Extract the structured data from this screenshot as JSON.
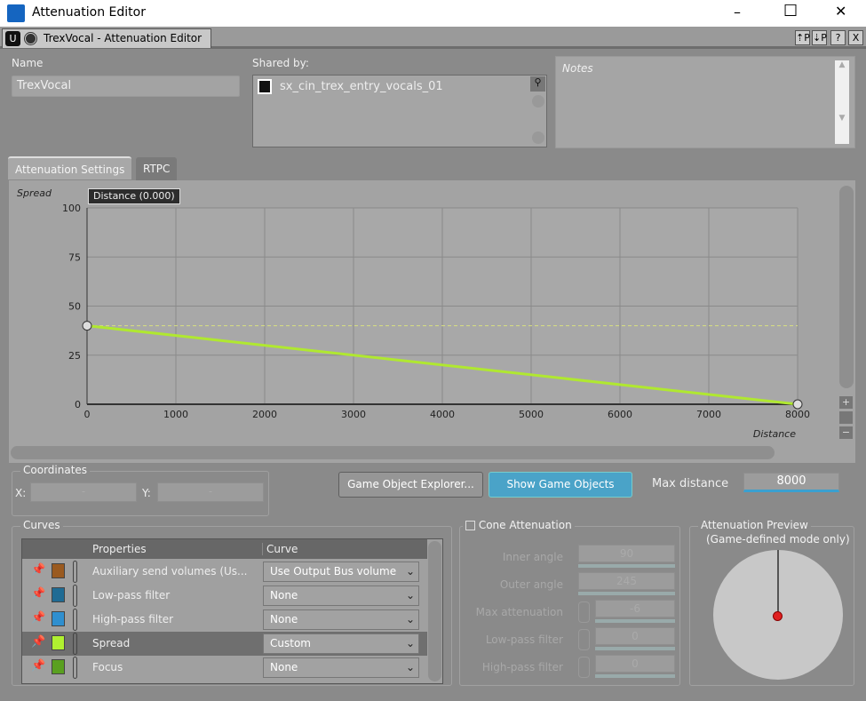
{
  "window": {
    "title": "Attenuation Editor",
    "minimize": "–",
    "maximize": "☐",
    "close": "✕"
  },
  "doc_tab": {
    "title": "TrexVocal - Attenuation Editor",
    "buttons": [
      "⇡P",
      "⇣P",
      "?",
      "X"
    ]
  },
  "name": {
    "label": "Name",
    "value": "TrexVocal"
  },
  "shared_by": {
    "label": "Shared by:",
    "items": [
      "sx_cin_trex_entry_vocals_01"
    ]
  },
  "notes": {
    "placeholder": "Notes"
  },
  "tabs": [
    {
      "label": "Attenuation Settings",
      "active": true
    },
    {
      "label": "RTPC",
      "active": false
    }
  ],
  "graph": {
    "tooltip": "Distance (0.000)"
  },
  "chart_data": {
    "type": "line",
    "ylabel": "Spread",
    "xlabel": "Distance",
    "xlim": [
      0,
      8000
    ],
    "ylim": [
      0,
      100
    ],
    "xticks": [
      0,
      1000,
      2000,
      3000,
      4000,
      5000,
      6000,
      7000,
      8000
    ],
    "yticks": [
      0,
      25,
      50,
      75,
      100
    ],
    "grid": true,
    "series": [
      {
        "name": "Spread",
        "color": "#b0e830",
        "points": [
          [
            0,
            40
          ],
          [
            8000,
            0
          ]
        ]
      }
    ],
    "reference_line": {
      "y": 40,
      "color": "#d8e080"
    }
  },
  "coordinates": {
    "label": "Coordinates",
    "x_label": "X:",
    "y_label": "Y:",
    "x_value": "-",
    "y_value": "-"
  },
  "buttons": {
    "explorer": "Game Object Explorer...",
    "show": "Show Game Objects"
  },
  "max_distance": {
    "label": "Max distance",
    "value": "8000"
  },
  "curves": {
    "label": "Curves",
    "headers": [
      "Properties",
      "Curve"
    ],
    "rows": [
      {
        "property": "Auxiliary send volumes (Us...",
        "curve": "Use Output Bus volume",
        "color": "#9a5a20",
        "selected": false
      },
      {
        "property": "Low-pass filter",
        "curve": "None",
        "color": "#1f6b94",
        "selected": false
      },
      {
        "property": "High-pass filter",
        "curve": "None",
        "color": "#2f8fcf",
        "selected": false
      },
      {
        "property": "Spread",
        "curve": "Custom",
        "color": "#b0f030",
        "selected": true
      },
      {
        "property": "Focus",
        "curve": "None",
        "color": "#5aa020",
        "selected": false
      }
    ]
  },
  "cone": {
    "label": "Cone Attenuation",
    "enabled": false,
    "fields": [
      {
        "label": "Inner angle",
        "value": "90"
      },
      {
        "label": "Outer angle",
        "value": "245"
      },
      {
        "label": "Max attenuation",
        "value": "-6"
      },
      {
        "label": "Low-pass filter",
        "value": "0"
      },
      {
        "label": "High-pass filter",
        "value": "0"
      }
    ]
  },
  "preview": {
    "label": "Attenuation Preview",
    "sublabel": "(Game-defined mode only)"
  }
}
